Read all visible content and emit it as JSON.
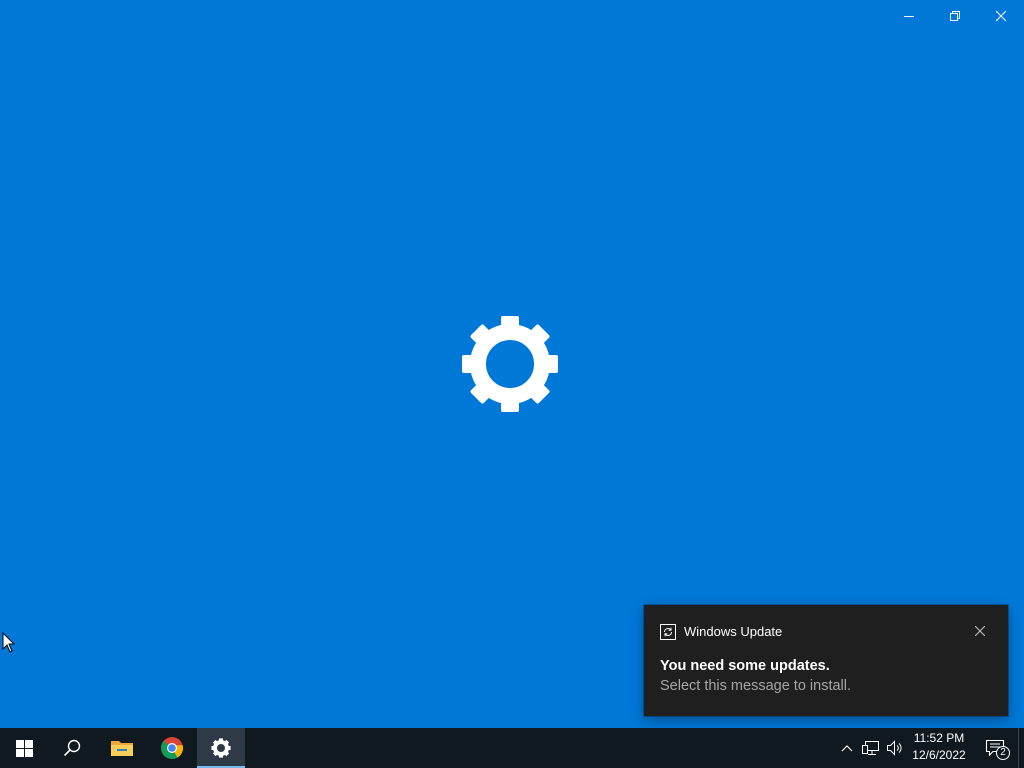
{
  "window": {
    "caption_buttons": {
      "minimize_icon": "minimize-icon",
      "restore_icon": "restore-icon",
      "close_icon": "close-icon"
    },
    "splash_icon": "gear-icon",
    "background_color": "#0078d7"
  },
  "notification": {
    "app_icon": "update-icon",
    "app_name": "Windows Update",
    "title": "You need some updates.",
    "body": "Select this message to install.",
    "close_icon": "close-icon",
    "background_color": "#1f1f1f"
  },
  "taskbar": {
    "pinned": [
      {
        "name": "start",
        "icon": "windows-logo-icon"
      },
      {
        "name": "search",
        "icon": "search-icon"
      },
      {
        "name": "file-explorer",
        "icon": "folder-icon"
      },
      {
        "name": "chrome",
        "icon": "chrome-icon"
      },
      {
        "name": "settings",
        "icon": "gear-icon",
        "active": true
      }
    ],
    "tray": {
      "chevron_icon": "chevron-up-icon",
      "network_icon": "network-icon",
      "volume_icon": "volume-icon",
      "time": "11:52 PM",
      "date": "12/6/2022",
      "action_center_icon": "action-center-icon",
      "notification_count": "2"
    },
    "background_color": "#101820",
    "active_indicator_color": "#76b9ed"
  }
}
